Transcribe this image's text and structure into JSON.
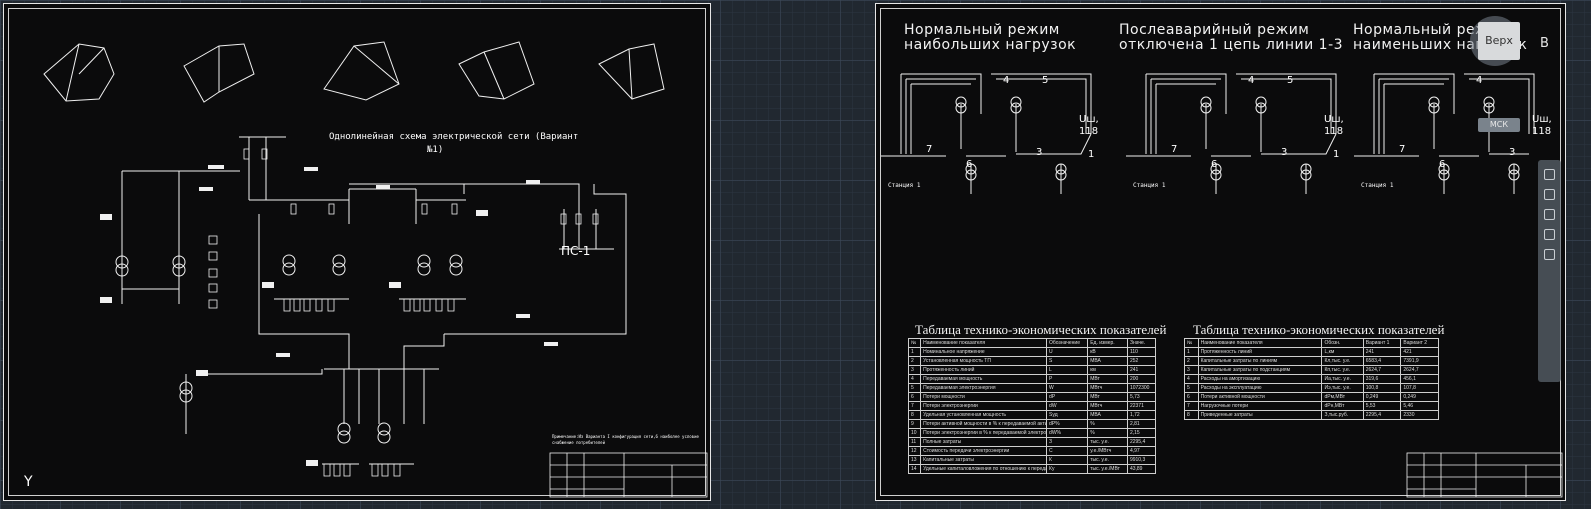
{
  "viewport": {
    "corner_label": "Y"
  },
  "nav": {
    "cube_top_label": "Верх",
    "coordinate_system": "МСК",
    "compass_letter": "В"
  },
  "left_sheet": {
    "title_line1": "Однолинейная схема электрической сети (Вариант",
    "title_line2": "№1)",
    "substation_label": "ПС-1",
    "note_line1": "Примечание:Из Варианта I конфигурация сети,6 наиболее условие",
    "note_line2": "снабжение потребителей"
  },
  "right_sheet": {
    "mode1": {
      "line1": "Нормальный режим",
      "line2": "наибольших нагрузок"
    },
    "mode2": {
      "line1": "Послеаварийный режим",
      "line2": "отключена 1 цепь линии 1-3"
    },
    "mode3": {
      "line1": "Нормальный режим",
      "line2": "наименьших нагрузок"
    },
    "bus_voltage_label": "Uш,",
    "bus_voltage_value": "118",
    "node_numbers": [
      "7",
      "4",
      "5",
      "6",
      "3",
      "1"
    ],
    "station_label": "Станция 1",
    "table1": {
      "title": "Таблица технико-экономических показателей",
      "header": [
        "№",
        "Наименование показателя",
        "Обозначение",
        "Ед. измер.",
        "Значе."
      ],
      "rows": [
        [
          "1",
          "Номинальное напряжение",
          "U",
          "кВ",
          "110"
        ],
        [
          "2",
          "Установленная мощность ТП",
          "S",
          "МВА",
          "252"
        ],
        [
          "3",
          "Протяженность линий",
          "L",
          "км",
          "241"
        ],
        [
          "4",
          "Передаваемая мощность",
          "P",
          "МВт",
          "200"
        ],
        [
          "5",
          "Передаваемая электроэнергия",
          "W",
          "МВтч",
          "1072300"
        ],
        [
          "6",
          "Потери мощности",
          "dP",
          "МВт",
          "5,73"
        ],
        [
          "7",
          "Потери электроэнергии",
          "dW",
          "МВтч",
          "22371"
        ],
        [
          "8",
          "Удельная установленная мощность",
          "Sуд",
          "МВА",
          "1,72"
        ],
        [
          "9",
          "Потери активной мощности в % к передаваемой активной мощности",
          "dP%",
          "%",
          "2,81"
        ],
        [
          "10",
          "Потери электроэнергии в % к передаваемой электроэнергии",
          "dW%",
          "%",
          "2,15"
        ],
        [
          "11",
          "Полные затраты",
          "З",
          "тыс. у.е.",
          "2295,4"
        ],
        [
          "12",
          "Стоимость передачи электроэнергии",
          "С",
          "у.е./МВтч",
          "4,97"
        ],
        [
          "13",
          "Капитальные затраты",
          "К",
          "тыс. у.е.",
          "9910,3"
        ],
        [
          "14",
          "Удельные капиталовложения по отношению к передаваемой мощности",
          "Ку",
          "тыс. у.е./МВт",
          "43,89"
        ]
      ]
    },
    "table2": {
      "title": "Таблица технико-экономических показателей",
      "header": [
        "№",
        "Наименование показателя",
        "Обозн.",
        "Вариант 1",
        "Вариант 2"
      ],
      "rows": [
        [
          "1",
          "Протяженность линий",
          "L,км",
          "241",
          "421"
        ],
        [
          "2",
          "Капитальные затраты по линиям",
          "Кл,тыс. у.е.",
          "6583,4",
          "7391,9"
        ],
        [
          "3",
          "Капитальные затраты по подстанциям",
          "Кп,тыс. у.е.",
          "2624,7",
          "2624,7"
        ],
        [
          "4",
          "Расходы на амортизацию",
          "Иа,тыс. у.е.",
          "319,6",
          "456,1"
        ],
        [
          "5",
          "Расходы на эксплуатацию",
          "Иэ,тыс. у.е.",
          "100,8",
          "107,8"
        ],
        [
          "6",
          "Потери активной мощности",
          "dPм,МВт",
          "0,249",
          "0,249"
        ],
        [
          "7",
          "Нагрузочные потери",
          "dPн,МВт",
          "5,53",
          "5,46"
        ],
        [
          "8",
          "Приведенные затраты",
          "З,тыс.руб.",
          "2295,4",
          "2330"
        ]
      ]
    }
  }
}
